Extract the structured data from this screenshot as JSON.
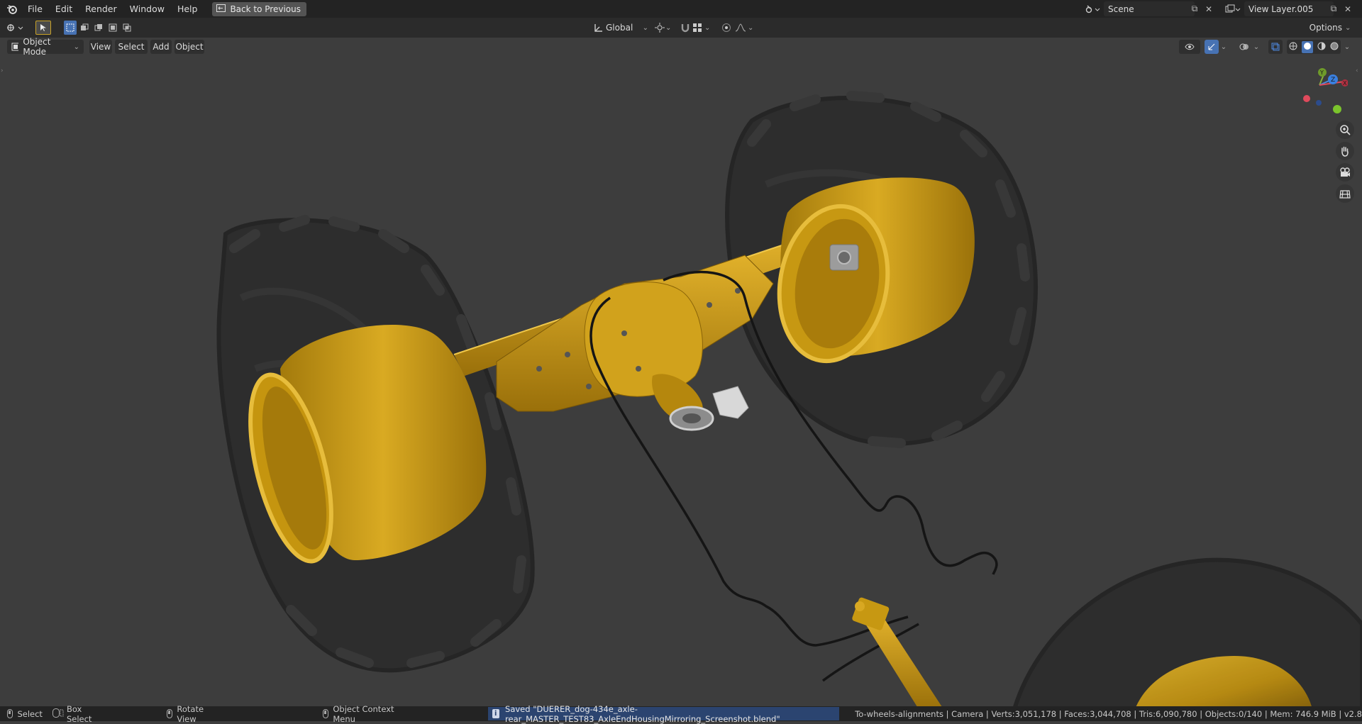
{
  "menu": {
    "file": "File",
    "edit": "Edit",
    "render": "Render",
    "window": "Window",
    "help": "Help",
    "back_to_previous": "Back to Previous"
  },
  "scene": {
    "name": "Scene",
    "view_layer": "View Layer.005"
  },
  "toolbar": {
    "transform_orientation": "Global",
    "options": "Options"
  },
  "viewport_header": {
    "mode": "Object Mode",
    "view": "View",
    "select": "Select",
    "add": "Add",
    "object": "Object"
  },
  "navigation_gizmo": {
    "axis_x": "X",
    "axis_y": "Y",
    "axis_z": "Z"
  },
  "statusbar": {
    "select": "Select",
    "box_select": "Box Select",
    "rotate_view": "Rotate View",
    "context_menu": "Object Context Menu",
    "saved_message": "Saved \"DUERER_dog-434e_axle-rear_MASTER_TEST83_AxleEndHousingMirroring_Screenshot.blend\"",
    "scene_stats": "To-wheels-alignments | Camera | Verts:3,051,178 | Faces:3,044,708 | Tris:6,090,780 | Objects:0/140 | Mem: 746.9 MiB | v2.8"
  },
  "colors": {
    "axle_yellow": "#c99a14",
    "tire_dark": "#2a2a2a",
    "viewport_bg": "#3d3d3d",
    "header_bg": "#232323",
    "accent_blue": "#4772b3",
    "saved_bg": "#2b4470"
  }
}
